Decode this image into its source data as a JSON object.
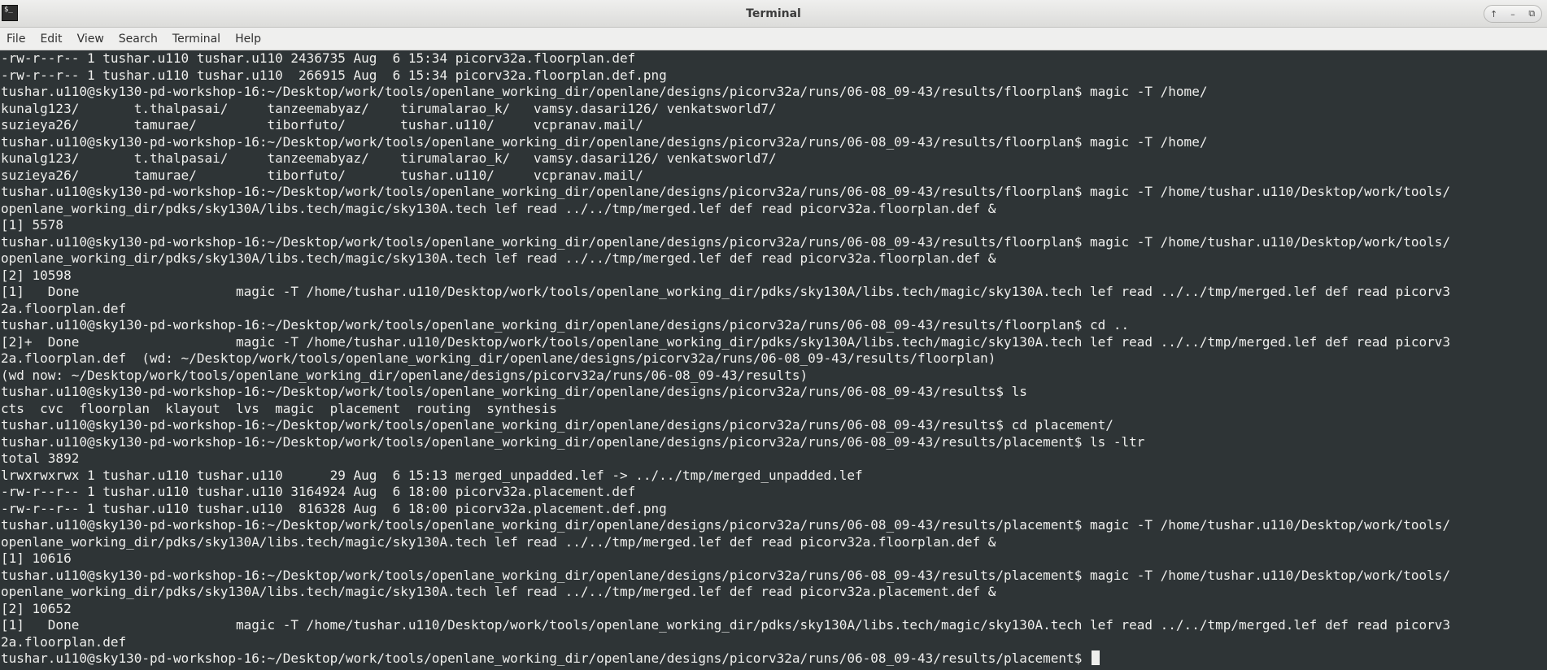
{
  "window": {
    "title": "Terminal",
    "app_icon_glyph": "$_",
    "controls": [
      "↑",
      "–",
      "⧉"
    ]
  },
  "menu": {
    "file": "File",
    "edit": "Edit",
    "view": "View",
    "search": "Search",
    "terminal": "Terminal",
    "help": "Help"
  },
  "terminal": {
    "lines": [
      "-rw-r--r-- 1 tushar.u110 tushar.u110 2436735 Aug  6 15:34 picorv32a.floorplan.def",
      "-rw-r--r-- 1 tushar.u110 tushar.u110  266915 Aug  6 15:34 picorv32a.floorplan.def.png",
      "tushar.u110@sky130-pd-workshop-16:~/Desktop/work/tools/openlane_working_dir/openlane/designs/picorv32a/runs/06-08_09-43/results/floorplan$ magic -T /home/",
      "kunalg123/       t.thalpasai/     tanzeemabyaz/    tirumalarao_k/   vamsy.dasari126/ venkatsworld7/",
      "suzieya26/       tamurae/         tiborfuto/       tushar.u110/     vcpranav.mail/",
      "tushar.u110@sky130-pd-workshop-16:~/Desktop/work/tools/openlane_working_dir/openlane/designs/picorv32a/runs/06-08_09-43/results/floorplan$ magic -T /home/",
      "kunalg123/       t.thalpasai/     tanzeemabyaz/    tirumalarao_k/   vamsy.dasari126/ venkatsworld7/",
      "suzieya26/       tamurae/         tiborfuto/       tushar.u110/     vcpranav.mail/",
      "tushar.u110@sky130-pd-workshop-16:~/Desktop/work/tools/openlane_working_dir/openlane/designs/picorv32a/runs/06-08_09-43/results/floorplan$ magic -T /home/tushar.u110/Desktop/work/tools/",
      "openlane_working_dir/pdks/sky130A/libs.tech/magic/sky130A.tech lef read ../../tmp/merged.lef def read picorv32a.floorplan.def &",
      "[1] 5578",
      "tushar.u110@sky130-pd-workshop-16:~/Desktop/work/tools/openlane_working_dir/openlane/designs/picorv32a/runs/06-08_09-43/results/floorplan$ magic -T /home/tushar.u110/Desktop/work/tools/",
      "openlane_working_dir/pdks/sky130A/libs.tech/magic/sky130A.tech lef read ../../tmp/merged.lef def read picorv32a.floorplan.def &",
      "[2] 10598",
      "[1]   Done                    magic -T /home/tushar.u110/Desktop/work/tools/openlane_working_dir/pdks/sky130A/libs.tech/magic/sky130A.tech lef read ../../tmp/merged.lef def read picorv3",
      "2a.floorplan.def",
      "tushar.u110@sky130-pd-workshop-16:~/Desktop/work/tools/openlane_working_dir/openlane/designs/picorv32a/runs/06-08_09-43/results/floorplan$ cd ..",
      "[2]+  Done                    magic -T /home/tushar.u110/Desktop/work/tools/openlane_working_dir/pdks/sky130A/libs.tech/magic/sky130A.tech lef read ../../tmp/merged.lef def read picorv3",
      "2a.floorplan.def  (wd: ~/Desktop/work/tools/openlane_working_dir/openlane/designs/picorv32a/runs/06-08_09-43/results/floorplan)",
      "(wd now: ~/Desktop/work/tools/openlane_working_dir/openlane/designs/picorv32a/runs/06-08_09-43/results)",
      "tushar.u110@sky130-pd-workshop-16:~/Desktop/work/tools/openlane_working_dir/openlane/designs/picorv32a/runs/06-08_09-43/results$ ls",
      "cts  cvc  floorplan  klayout  lvs  magic  placement  routing  synthesis",
      "tushar.u110@sky130-pd-workshop-16:~/Desktop/work/tools/openlane_working_dir/openlane/designs/picorv32a/runs/06-08_09-43/results$ cd placement/",
      "tushar.u110@sky130-pd-workshop-16:~/Desktop/work/tools/openlane_working_dir/openlane/designs/picorv32a/runs/06-08_09-43/results/placement$ ls -ltr",
      "total 3892",
      "lrwxrwxrwx 1 tushar.u110 tushar.u110      29 Aug  6 15:13 merged_unpadded.lef -> ../../tmp/merged_unpadded.lef",
      "-rw-r--r-- 1 tushar.u110 tushar.u110 3164924 Aug  6 18:00 picorv32a.placement.def",
      "-rw-r--r-- 1 tushar.u110 tushar.u110  816328 Aug  6 18:00 picorv32a.placement.def.png",
      "tushar.u110@sky130-pd-workshop-16:~/Desktop/work/tools/openlane_working_dir/openlane/designs/picorv32a/runs/06-08_09-43/results/placement$ magic -T /home/tushar.u110/Desktop/work/tools/",
      "openlane_working_dir/pdks/sky130A/libs.tech/magic/sky130A.tech lef read ../../tmp/merged.lef def read picorv32a.floorplan.def &",
      "[1] 10616",
      "tushar.u110@sky130-pd-workshop-16:~/Desktop/work/tools/openlane_working_dir/openlane/designs/picorv32a/runs/06-08_09-43/results/placement$ magic -T /home/tushar.u110/Desktop/work/tools/",
      "openlane_working_dir/pdks/sky130A/libs.tech/magic/sky130A.tech lef read ../../tmp/merged.lef def read picorv32a.placement.def &",
      "[2] 10652",
      "[1]   Done                    magic -T /home/tushar.u110/Desktop/work/tools/openlane_working_dir/pdks/sky130A/libs.tech/magic/sky130A.tech lef read ../../tmp/merged.lef def read picorv3",
      "2a.floorplan.def",
      "tushar.u110@sky130-pd-workshop-16:~/Desktop/work/tools/openlane_working_dir/openlane/designs/picorv32a/runs/06-08_09-43/results/placement$ "
    ],
    "colors": {
      "background": "#2e3436",
      "foreground": "#eeeeec"
    }
  }
}
